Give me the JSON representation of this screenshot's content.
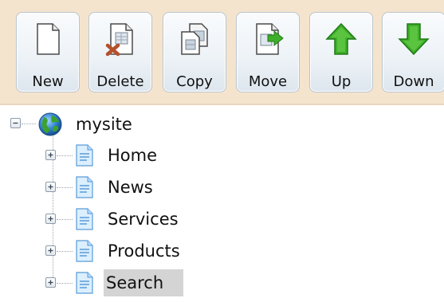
{
  "toolbar": {
    "buttons": [
      {
        "id": "new",
        "label": "New",
        "icon": "new-document-icon"
      },
      {
        "id": "delete",
        "label": "Delete",
        "icon": "delete-document-icon"
      },
      {
        "id": "copy",
        "label": "Copy",
        "icon": "copy-documents-icon"
      },
      {
        "id": "move",
        "label": "Move",
        "icon": "move-document-icon"
      },
      {
        "id": "up",
        "label": "Up",
        "icon": "green-arrow-up-icon"
      },
      {
        "id": "down",
        "label": "Down",
        "icon": "green-arrow-down-icon"
      }
    ]
  },
  "tree": {
    "root": {
      "label": "mysite",
      "icon": "globe-icon",
      "expanded": true
    },
    "children": [
      {
        "label": "Home",
        "icon": "page-icon",
        "expanded": false,
        "selected": false
      },
      {
        "label": "News",
        "icon": "page-icon",
        "expanded": false,
        "selected": false
      },
      {
        "label": "Services",
        "icon": "page-icon",
        "expanded": false,
        "selected": false
      },
      {
        "label": "Products",
        "icon": "page-icon",
        "expanded": false,
        "selected": false
      },
      {
        "label": "Search",
        "icon": "page-icon",
        "expanded": false,
        "selected": true
      }
    ]
  },
  "colors": {
    "toolbar_bg": "#f4e4cd",
    "selection_bg": "#d4d4d4",
    "arrow_green": "#3fae2a"
  }
}
